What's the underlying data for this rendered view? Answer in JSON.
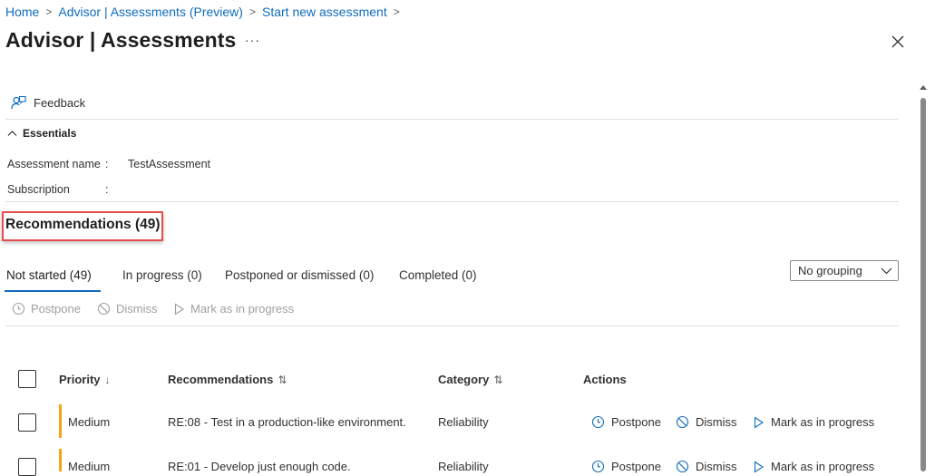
{
  "breadcrumb": {
    "items": [
      "Home",
      "Advisor | Assessments (Preview)",
      "Start new assessment"
    ],
    "separator": ">"
  },
  "page": {
    "title": "Advisor | Assessments",
    "more_label": "···"
  },
  "toolbar": {
    "feedback_label": "Feedback"
  },
  "essentials": {
    "label": "Essentials",
    "properties": [
      {
        "key": "Assessment name",
        "colon": ":",
        "value": "TestAssessment"
      },
      {
        "key": "Subscription",
        "colon": ":",
        "value": ""
      }
    ]
  },
  "recommendations": {
    "heading": "Recommendations (49)"
  },
  "tabs": [
    {
      "label": "Not started (49)",
      "active": true
    },
    {
      "label": "In progress (0)",
      "active": false
    },
    {
      "label": "Postponed or dismissed (0)",
      "active": false
    },
    {
      "label": "Completed (0)",
      "active": false
    }
  ],
  "grouping": {
    "selected": "No grouping"
  },
  "actions_bar": {
    "postpone": "Postpone",
    "dismiss": "Dismiss",
    "mark_in_progress": "Mark as in progress"
  },
  "table": {
    "headers": {
      "priority": "Priority",
      "priority_sort": "↓",
      "recommendations": "Recommendations",
      "recommendations_sort": "⇅",
      "category": "Category",
      "category_sort": "⇅",
      "actions": "Actions"
    },
    "rows": [
      {
        "priority": "Medium",
        "recommendation": "RE:08 - Test in a production-like environment.",
        "category": "Reliability",
        "postpone": "Postpone",
        "dismiss": "Dismiss",
        "mark": "Mark as in progress"
      },
      {
        "priority": "Medium",
        "recommendation": "RE:01 - Develop just enough code.",
        "category": "Reliability",
        "postpone": "Postpone",
        "dismiss": "Dismiss",
        "mark": "Mark as in progress"
      }
    ]
  },
  "colors": {
    "link": "#0f6cbd",
    "priority_medium": "#f7a214",
    "highlight_box": "#e74c4c"
  }
}
